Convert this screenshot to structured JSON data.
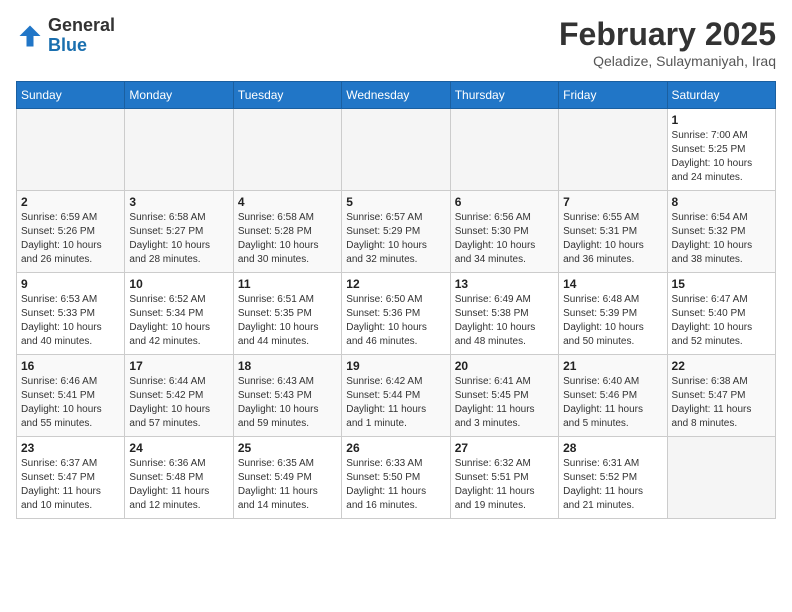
{
  "logo": {
    "general": "General",
    "blue": "Blue"
  },
  "header": {
    "month_year": "February 2025",
    "location": "Qeladize, Sulaymaniyah, Iraq"
  },
  "days_of_week": [
    "Sunday",
    "Monday",
    "Tuesday",
    "Wednesday",
    "Thursday",
    "Friday",
    "Saturday"
  ],
  "weeks": [
    [
      {
        "day": "",
        "info": ""
      },
      {
        "day": "",
        "info": ""
      },
      {
        "day": "",
        "info": ""
      },
      {
        "day": "",
        "info": ""
      },
      {
        "day": "",
        "info": ""
      },
      {
        "day": "",
        "info": ""
      },
      {
        "day": "1",
        "info": "Sunrise: 7:00 AM\nSunset: 5:25 PM\nDaylight: 10 hours\nand 24 minutes."
      }
    ],
    [
      {
        "day": "2",
        "info": "Sunrise: 6:59 AM\nSunset: 5:26 PM\nDaylight: 10 hours\nand 26 minutes."
      },
      {
        "day": "3",
        "info": "Sunrise: 6:58 AM\nSunset: 5:27 PM\nDaylight: 10 hours\nand 28 minutes."
      },
      {
        "day": "4",
        "info": "Sunrise: 6:58 AM\nSunset: 5:28 PM\nDaylight: 10 hours\nand 30 minutes."
      },
      {
        "day": "5",
        "info": "Sunrise: 6:57 AM\nSunset: 5:29 PM\nDaylight: 10 hours\nand 32 minutes."
      },
      {
        "day": "6",
        "info": "Sunrise: 6:56 AM\nSunset: 5:30 PM\nDaylight: 10 hours\nand 34 minutes."
      },
      {
        "day": "7",
        "info": "Sunrise: 6:55 AM\nSunset: 5:31 PM\nDaylight: 10 hours\nand 36 minutes."
      },
      {
        "day": "8",
        "info": "Sunrise: 6:54 AM\nSunset: 5:32 PM\nDaylight: 10 hours\nand 38 minutes."
      }
    ],
    [
      {
        "day": "9",
        "info": "Sunrise: 6:53 AM\nSunset: 5:33 PM\nDaylight: 10 hours\nand 40 minutes."
      },
      {
        "day": "10",
        "info": "Sunrise: 6:52 AM\nSunset: 5:34 PM\nDaylight: 10 hours\nand 42 minutes."
      },
      {
        "day": "11",
        "info": "Sunrise: 6:51 AM\nSunset: 5:35 PM\nDaylight: 10 hours\nand 44 minutes."
      },
      {
        "day": "12",
        "info": "Sunrise: 6:50 AM\nSunset: 5:36 PM\nDaylight: 10 hours\nand 46 minutes."
      },
      {
        "day": "13",
        "info": "Sunrise: 6:49 AM\nSunset: 5:38 PM\nDaylight: 10 hours\nand 48 minutes."
      },
      {
        "day": "14",
        "info": "Sunrise: 6:48 AM\nSunset: 5:39 PM\nDaylight: 10 hours\nand 50 minutes."
      },
      {
        "day": "15",
        "info": "Sunrise: 6:47 AM\nSunset: 5:40 PM\nDaylight: 10 hours\nand 52 minutes."
      }
    ],
    [
      {
        "day": "16",
        "info": "Sunrise: 6:46 AM\nSunset: 5:41 PM\nDaylight: 10 hours\nand 55 minutes."
      },
      {
        "day": "17",
        "info": "Sunrise: 6:44 AM\nSunset: 5:42 PM\nDaylight: 10 hours\nand 57 minutes."
      },
      {
        "day": "18",
        "info": "Sunrise: 6:43 AM\nSunset: 5:43 PM\nDaylight: 10 hours\nand 59 minutes."
      },
      {
        "day": "19",
        "info": "Sunrise: 6:42 AM\nSunset: 5:44 PM\nDaylight: 11 hours\nand 1 minute."
      },
      {
        "day": "20",
        "info": "Sunrise: 6:41 AM\nSunset: 5:45 PM\nDaylight: 11 hours\nand 3 minutes."
      },
      {
        "day": "21",
        "info": "Sunrise: 6:40 AM\nSunset: 5:46 PM\nDaylight: 11 hours\nand 5 minutes."
      },
      {
        "day": "22",
        "info": "Sunrise: 6:38 AM\nSunset: 5:47 PM\nDaylight: 11 hours\nand 8 minutes."
      }
    ],
    [
      {
        "day": "23",
        "info": "Sunrise: 6:37 AM\nSunset: 5:47 PM\nDaylight: 11 hours\nand 10 minutes."
      },
      {
        "day": "24",
        "info": "Sunrise: 6:36 AM\nSunset: 5:48 PM\nDaylight: 11 hours\nand 12 minutes."
      },
      {
        "day": "25",
        "info": "Sunrise: 6:35 AM\nSunset: 5:49 PM\nDaylight: 11 hours\nand 14 minutes."
      },
      {
        "day": "26",
        "info": "Sunrise: 6:33 AM\nSunset: 5:50 PM\nDaylight: 11 hours\nand 16 minutes."
      },
      {
        "day": "27",
        "info": "Sunrise: 6:32 AM\nSunset: 5:51 PM\nDaylight: 11 hours\nand 19 minutes."
      },
      {
        "day": "28",
        "info": "Sunrise: 6:31 AM\nSunset: 5:52 PM\nDaylight: 11 hours\nand 21 minutes."
      },
      {
        "day": "",
        "info": ""
      }
    ]
  ]
}
